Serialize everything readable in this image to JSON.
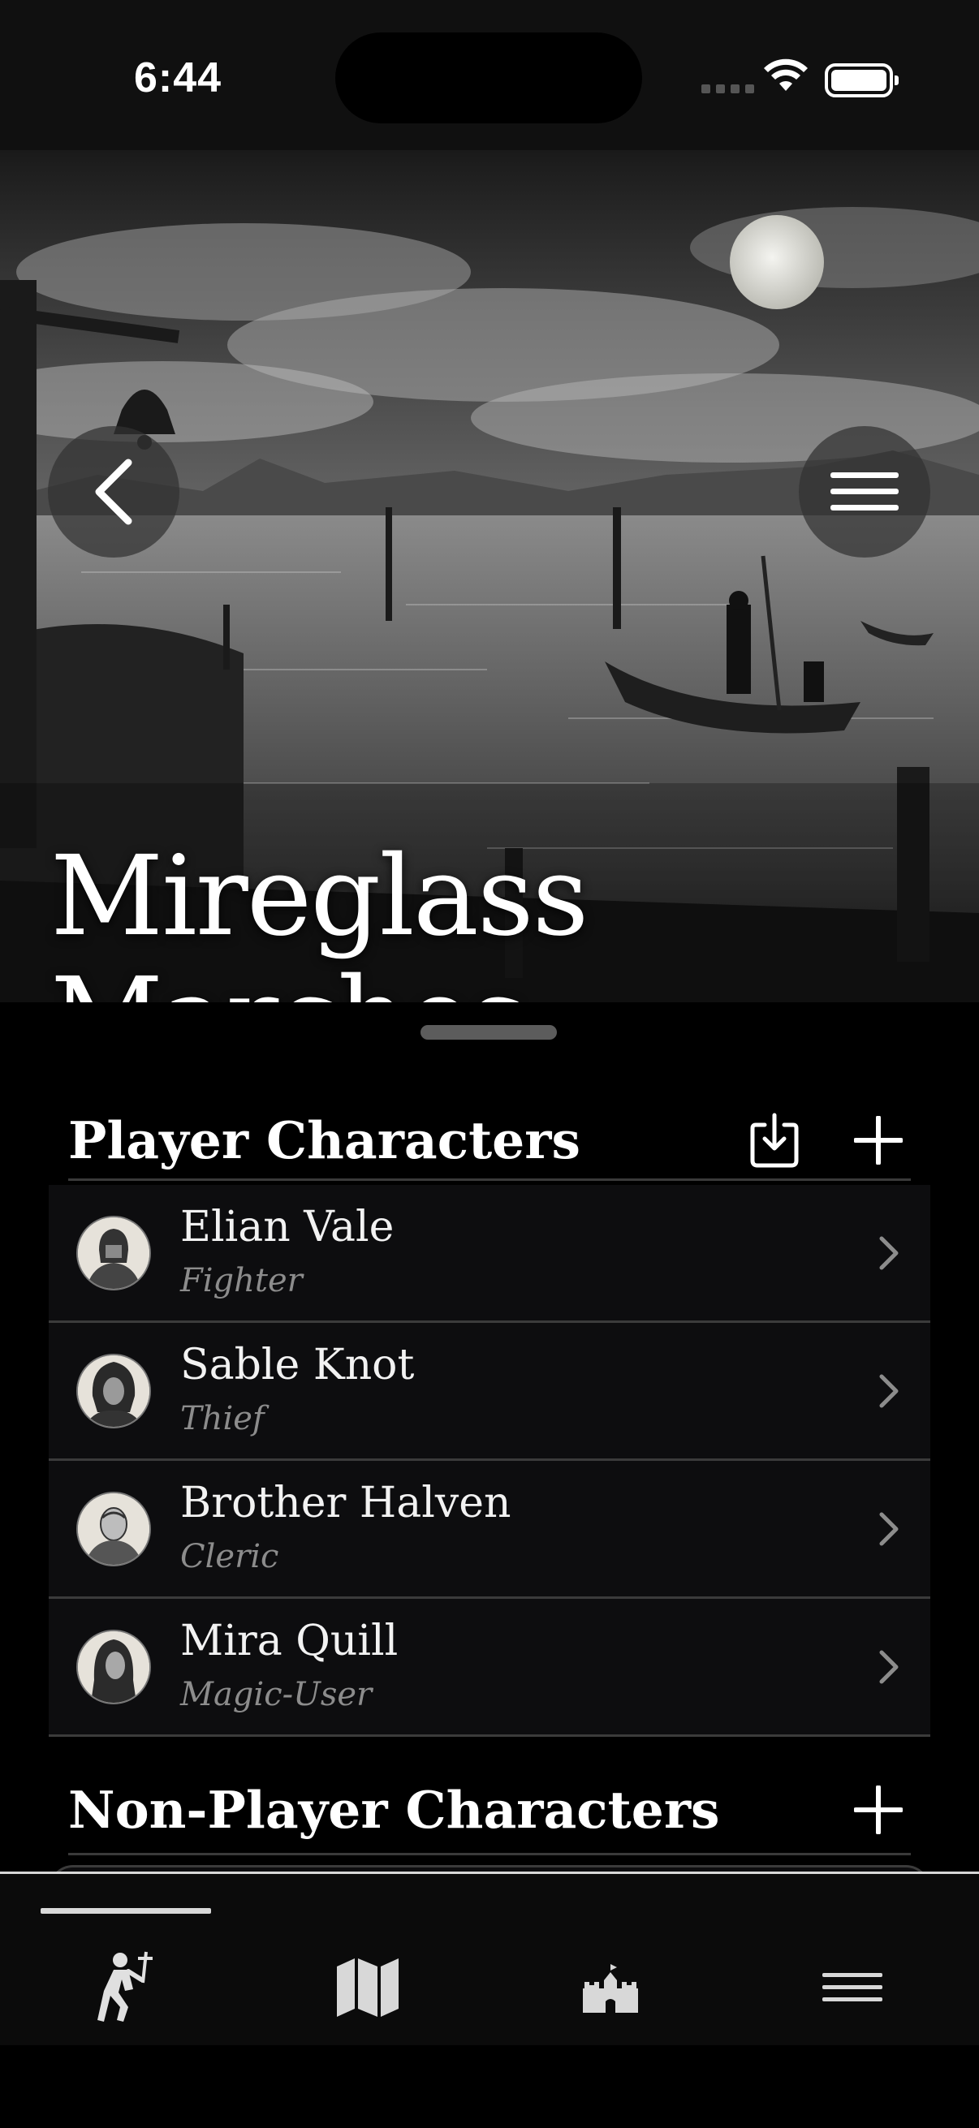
{
  "status_bar": {
    "time": "6:44"
  },
  "hero": {
    "title_line1": "Mireglass",
    "title_line2": "Marches",
    "back_icon": "chevron-left-icon",
    "menu_icon": "hamburger-icon"
  },
  "player_characters": {
    "title": "Player Characters",
    "import_icon": "download-tray-icon",
    "add_icon": "plus-icon",
    "items": [
      {
        "name": "Elian Vale",
        "class": "Fighter"
      },
      {
        "name": "Sable Knot",
        "class": "Thief"
      },
      {
        "name": "Brother Halven",
        "class": "Cleric"
      },
      {
        "name": "Mira Quill",
        "class": "Magic-User"
      }
    ]
  },
  "npcs": {
    "title": "Non-Player Characters",
    "add_icon": "plus-icon"
  },
  "tab_bar": {
    "tabs": [
      "characters-tab",
      "map-tab",
      "castle-tab",
      "more-tab"
    ],
    "selected": "characters-tab"
  },
  "colors": {
    "background": "#000000",
    "row_bg": "#0d0d0f",
    "divider": "#3b3b3b",
    "secondary_text": "#8c8c8c"
  }
}
